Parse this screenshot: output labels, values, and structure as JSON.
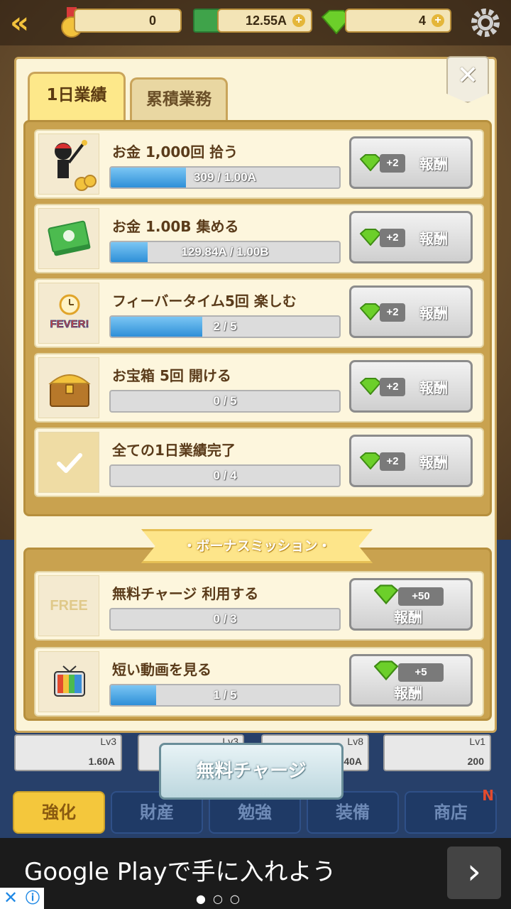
{
  "topbar": {
    "medals": "0",
    "money": "12.55A",
    "gems": "4",
    "plus": "+"
  },
  "tabs": [
    {
      "label": "1日業績"
    },
    {
      "label": "累積業務"
    }
  ],
  "close_label": "✕",
  "daily": [
    {
      "title": "お金 1,000回 拾う",
      "progress_text": "309 / 1.00A",
      "progress": 0.33,
      "reward": "+2",
      "reward_label": "報酬"
    },
    {
      "title": "お金 1.00B 集める",
      "progress_text": "129.84A / 1.00B",
      "progress": 0.16,
      "reward": "+2",
      "reward_label": "報酬"
    },
    {
      "title": "フィーバータイム5回 楽しむ",
      "progress_text": "2 / 5",
      "progress": 0.4,
      "reward": "+2",
      "reward_label": "報酬"
    },
    {
      "title": "お宝箱 5回 開ける",
      "progress_text": "0 / 5",
      "progress": 0,
      "reward": "+2",
      "reward_label": "報酬"
    },
    {
      "title": "全ての1日業績完了",
      "progress_text": "0 / 4",
      "progress": 0,
      "reward": "+2",
      "reward_label": "報酬"
    }
  ],
  "bonus_title": "・ボーナスミッション・",
  "bonus": [
    {
      "title": "無料チャージ 利用する",
      "progress_text": "0 / 3",
      "progress": 0,
      "reward": "+50",
      "reward_label": "報酬",
      "thumb_text": "FREE"
    },
    {
      "title": "短い動画を見る",
      "progress_text": "1 / 5",
      "progress": 0.2,
      "reward": "+5",
      "reward_label": "報酬"
    }
  ],
  "fever_label": "FEVER!",
  "cards": [
    {
      "lv": "Lv3",
      "cost": "1.60A"
    },
    {
      "lv": "Lv3",
      "cost": ""
    },
    {
      "lv": "Lv8",
      "cost": "40A"
    },
    {
      "lv": "Lv1",
      "cost": "200"
    }
  ],
  "free_charge_label": "無料チャージ",
  "nav": [
    {
      "label": "強化"
    },
    {
      "label": "財産"
    },
    {
      "label": "勉強"
    },
    {
      "label": "装備"
    },
    {
      "label": "商店",
      "badge": "N"
    }
  ],
  "ad": {
    "text": "Google Playで手に入れよう",
    "arrow": "›",
    "dots": "●○○"
  },
  "colors": {
    "accent": "#f4c73c",
    "progress": "#2e8fd8",
    "gem": "#6ccf2a"
  }
}
